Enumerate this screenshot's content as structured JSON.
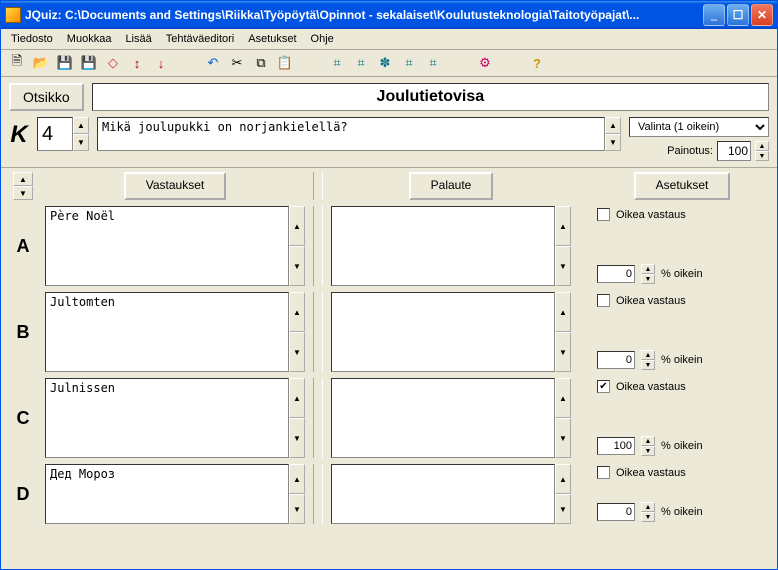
{
  "window": {
    "title": "JQuiz: C:\\Documents and Settings\\Riikka\\Työpöytä\\Opinnot - sekalaiset\\Koulutusteknologia\\Taitotyöpajat\\..."
  },
  "menu": {
    "tiedosto": "Tiedosto",
    "muokkaa": "Muokkaa",
    "lisaa": "Lisää",
    "tehtavaeditori": "Tehtäväeditori",
    "asetukset": "Asetukset",
    "ohje": "Ohje"
  },
  "labels": {
    "otsikko": "Otsikko",
    "k": "K",
    "painotus": "Painotus:",
    "vastaukset": "Vastaukset",
    "palaute": "Palaute",
    "asetukset": "Asetukset",
    "oikea_vastaus": "Oikea vastaus",
    "pct_oikein": "% oikein"
  },
  "quiz_title": "Joulutietovisa",
  "question_number": "4",
  "question_text": "Mikä joulupukki on norjankielellä?",
  "qtype_selected": "Valinta (1 oikein)",
  "weight": "100",
  "answers": [
    {
      "letter": "A",
      "text": "Père Noël",
      "feedback": "",
      "correct": false,
      "pct": "0"
    },
    {
      "letter": "B",
      "text": "Jultomten",
      "feedback": "",
      "correct": false,
      "pct": "0"
    },
    {
      "letter": "C",
      "text": "Julnissen",
      "feedback": "",
      "correct": true,
      "pct": "100"
    },
    {
      "letter": "D",
      "text": "Дед Мороз",
      "feedback": "",
      "correct": false,
      "pct": "0"
    }
  ]
}
